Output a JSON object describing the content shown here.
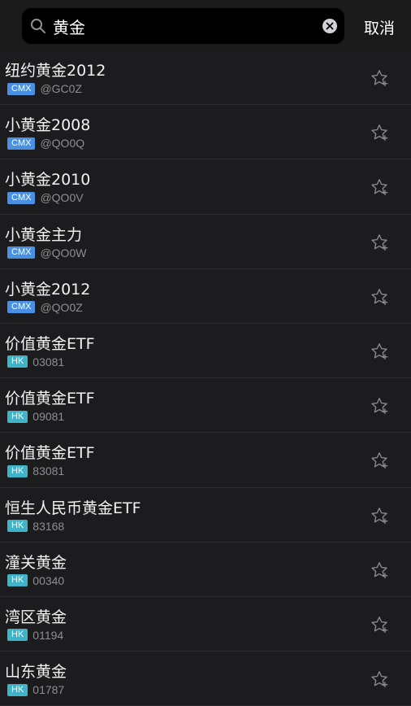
{
  "search": {
    "value": "黄金",
    "cancel_label": "取消"
  },
  "colors": {
    "CMX": "#4a90e2",
    "HK": "#3fb3c8"
  },
  "results": [
    {
      "name": "纽约黄金2012",
      "exchange": "CMX",
      "code": "@GC0Z"
    },
    {
      "name": "小黄金2008",
      "exchange": "CMX",
      "code": "@QO0Q"
    },
    {
      "name": "小黄金2010",
      "exchange": "CMX",
      "code": "@QO0V"
    },
    {
      "name": "小黄金主力",
      "exchange": "CMX",
      "code": "@QO0W"
    },
    {
      "name": "小黄金2012",
      "exchange": "CMX",
      "code": "@QO0Z"
    },
    {
      "name": "价值黄金ETF",
      "exchange": "HK",
      "code": "03081"
    },
    {
      "name": "价值黄金ETF",
      "exchange": "HK",
      "code": "09081"
    },
    {
      "name": "价值黄金ETF",
      "exchange": "HK",
      "code": "83081"
    },
    {
      "name": "恒生人民币黄金ETF",
      "exchange": "HK",
      "code": "83168"
    },
    {
      "name": "潼关黄金",
      "exchange": "HK",
      "code": "00340"
    },
    {
      "name": "湾区黄金",
      "exchange": "HK",
      "code": "01194"
    },
    {
      "name": "山东黄金",
      "exchange": "HK",
      "code": "01787"
    }
  ]
}
